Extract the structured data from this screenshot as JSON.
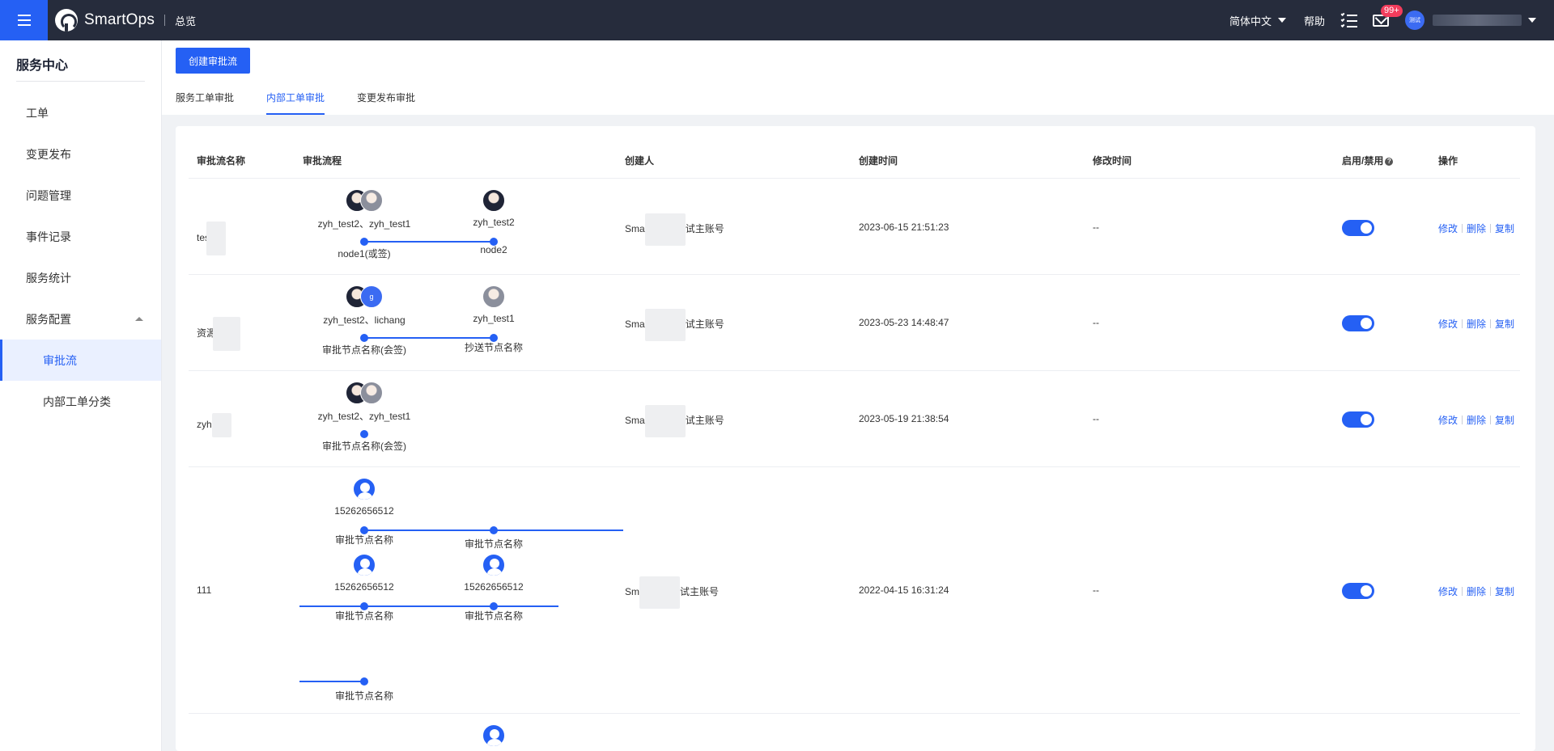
{
  "app": {
    "brand": "SmartOps",
    "nav_current": "总览",
    "language": "简体中文",
    "help": "帮助",
    "mail_badge": "99+",
    "user_avatar_text": "测试"
  },
  "sidebar": {
    "title": "服务中心",
    "items": [
      {
        "label": "工单"
      },
      {
        "label": "变更发布"
      },
      {
        "label": "问题管理"
      },
      {
        "label": "事件记录"
      },
      {
        "label": "服务统计"
      },
      {
        "label": "服务配置"
      }
    ],
    "sub_items": [
      {
        "label": "审批流"
      },
      {
        "label": "内部工单分类"
      }
    ]
  },
  "toolbar": {
    "create_label": "创建审批流"
  },
  "tabs": [
    {
      "label": "服务工单审批"
    },
    {
      "label": "内部工单审批"
    },
    {
      "label": "变更发布审批"
    }
  ],
  "table": {
    "headers": {
      "name": "审批流名称",
      "flow": "审批流程",
      "creator": "创建人",
      "created": "创建时间",
      "modified": "修改时间",
      "enable": "启用/禁用",
      "ops": "操作"
    },
    "ops": {
      "edit": "修改",
      "delete": "删除",
      "copy": "复制"
    },
    "rows": [
      {
        "name": "tes",
        "creator_prefix": "Sma",
        "creator_suffix": "试主账号",
        "created": "2023-06-15 21:51:23",
        "modified": "--",
        "enabled": true,
        "nodes": [
          {
            "users": "zyh_test2、zyh_test1",
            "name": "node1(或签)"
          },
          {
            "users": "zyh_test2",
            "name": "node2"
          }
        ]
      },
      {
        "name": "资源",
        "creator_prefix": "Sma",
        "creator_suffix": "试主账号",
        "created": "2023-05-23 14:48:47",
        "modified": "--",
        "enabled": true,
        "nodes": [
          {
            "users": "zyh_test2、lichang",
            "name": "审批节点名称(会签)",
            "avatar_letter": "g"
          },
          {
            "users": "zyh_test1",
            "name": "抄送节点名称"
          }
        ]
      },
      {
        "name": "zyh-",
        "creator_prefix": "Sma",
        "creator_suffix": "试主账号",
        "created": "2023-05-19 21:38:54",
        "modified": "--",
        "enabled": true,
        "nodes": [
          {
            "users": "zyh_test2、zyh_test1",
            "name": "审批节点名称(会签)"
          }
        ]
      },
      {
        "name": "111",
        "creator_prefix": "Sm",
        "creator_suffix": "试主账号",
        "created": "2022-04-15 16:31:24",
        "modified": "--",
        "enabled": true,
        "nodes": [
          {
            "users": "15262656512",
            "name": "审批节点名称"
          },
          {
            "users": "",
            "name": "审批节点名称"
          },
          {
            "users": "15262656512",
            "name": "审批节点名称"
          },
          {
            "users": "15262656512",
            "name": "审批节点名称"
          },
          {
            "users": "",
            "name": "审批节点名称"
          }
        ]
      }
    ]
  },
  "colors": {
    "primary": "#2560f4",
    "topbar": "#262c3c",
    "badge": "#f23c5c"
  }
}
